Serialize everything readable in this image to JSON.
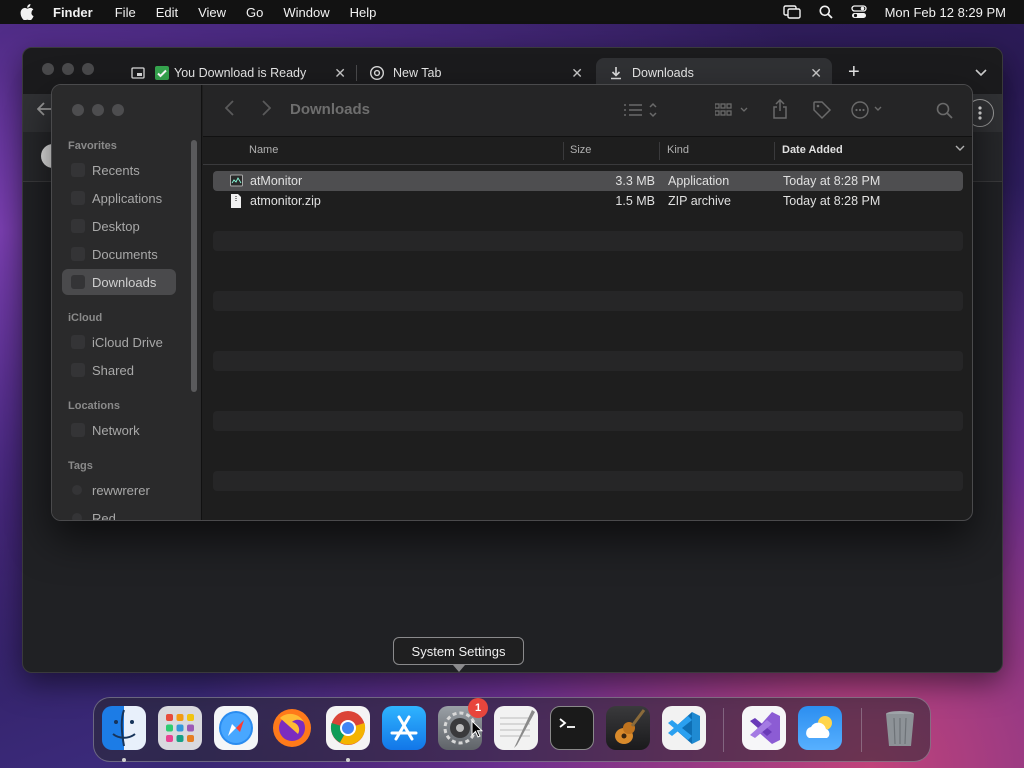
{
  "menubar": {
    "app_name": "Finder",
    "items": [
      "File",
      "Edit",
      "View",
      "Go",
      "Window",
      "Help"
    ],
    "clock": "Mon Feb 12  8:29 PM"
  },
  "browser": {
    "tabs": [
      {
        "label": "You Download is Ready",
        "icon": "window-icon",
        "prefix_icon": "checkmark-icon"
      },
      {
        "label": "New Tab",
        "icon": "chrome-icon"
      },
      {
        "label": "Downloads",
        "icon": "download-icon",
        "active": true
      }
    ]
  },
  "finder": {
    "title": "Downloads",
    "sidebar": {
      "sections": [
        {
          "title": "Favorites",
          "items": [
            "Recents",
            "Applications",
            "Desktop",
            "Documents",
            "Downloads"
          ]
        },
        {
          "title": "iCloud",
          "items": [
            "iCloud Drive",
            "Shared"
          ]
        },
        {
          "title": "Locations",
          "items": [
            "Network"
          ]
        },
        {
          "title": "Tags",
          "items": [
            "rewwrerer",
            "Red"
          ]
        }
      ],
      "selected": "Downloads"
    },
    "columns": {
      "name": "Name",
      "size": "Size",
      "kind": "Kind",
      "date": "Date Added"
    },
    "files": [
      {
        "name": "atMonitor",
        "size": "3.3 MB",
        "kind": "Application",
        "date": "Today at 8:28 PM",
        "selected": true
      },
      {
        "name": "atmonitor.zip",
        "size": "1.5 MB",
        "kind": "ZIP archive",
        "date": "Today at 8:28 PM",
        "selected": false
      }
    ]
  },
  "tooltip": "System Settings",
  "dock": {
    "apps": [
      "Finder",
      "Launchpad",
      "Safari",
      "Firefox",
      "Google Chrome",
      "App Store",
      "System Settings",
      "TextEdit",
      "Terminal",
      "GarageBand",
      "Visual Studio Code",
      "Visual Studio",
      "Weather",
      "Trash"
    ],
    "badge": "1"
  },
  "colors": {
    "menubar_bg": "#121212",
    "finder_bg": "#1e1e1e",
    "selection": "#4e4e50",
    "badge": "#e8453c"
  }
}
